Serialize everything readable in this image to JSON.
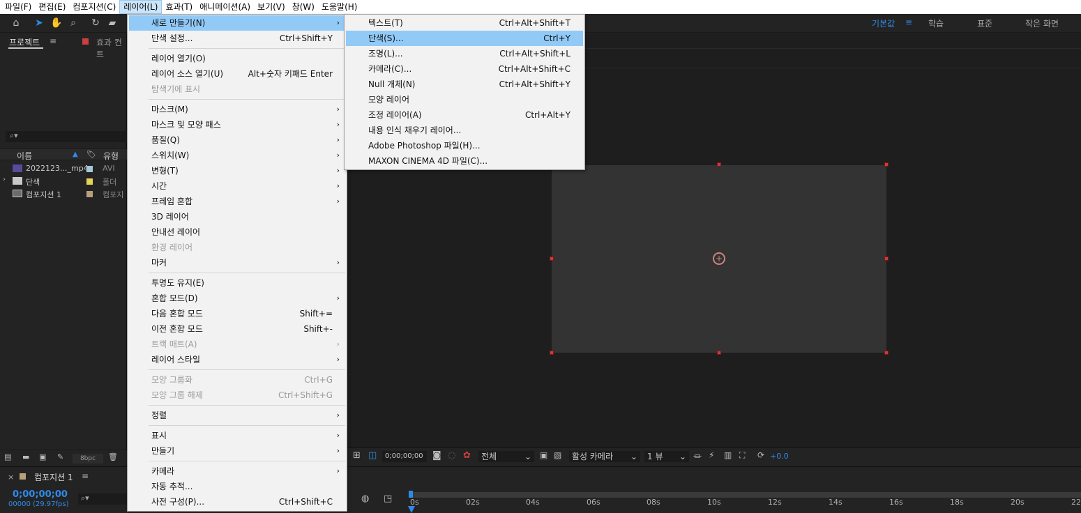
{
  "menubar": {
    "items": [
      "파일(F)",
      "편집(E)",
      "컴포지션(C)",
      "레이어(L)",
      "효과(T)",
      "애니메이션(A)",
      "보기(V)",
      "창(W)",
      "도움말(H)"
    ]
  },
  "workspaces": {
    "active": "기본값",
    "items": [
      "학습",
      "표준",
      "작은 화면"
    ]
  },
  "project_panel": {
    "tab_label": "프로젝트",
    "effects_tab_label": "효과 컨트",
    "columns": {
      "name": "이름",
      "type": "유형"
    },
    "rows": [
      {
        "name": "2022123..._mp4",
        "swatch": "#a6c8d6",
        "type": "AVI"
      },
      {
        "name": "단색",
        "swatch": "#e6d454",
        "type": "폴더"
      },
      {
        "name": "컴포지션 1",
        "swatch": "#b8a07c",
        "type": "컴포지"
      }
    ],
    "bit_depth": "8bpc"
  },
  "timeline": {
    "tab_label": "컴포지션 1",
    "timecode": "0;00;00;00",
    "frame_info": "00000 (29.97fps)",
    "ruler": [
      "0s",
      "02s",
      "04s",
      "06s",
      "08s",
      "10s",
      "12s",
      "14s",
      "16s",
      "18s",
      "20s",
      "22"
    ]
  },
  "viewer_bar": {
    "timecode": "0;00;00;00",
    "resolution": "전체",
    "camera": "활성 카메라",
    "views": "1 뷰",
    "exposure": "+0.0"
  },
  "layer_menu": {
    "items": [
      {
        "label": "새로 만들기(N)",
        "submenu": true,
        "highlight": true
      },
      {
        "label": "단색 설정...",
        "shortcut": "Ctrl+Shift+Y"
      },
      {
        "sep": true
      },
      {
        "label": "레이어 열기(O)"
      },
      {
        "label": "레이어 소스 열기(U)",
        "shortcut": "Alt+숫자 키패드 Enter"
      },
      {
        "label": "탐색기에 표시",
        "disabled": true
      },
      {
        "sep": true
      },
      {
        "label": "마스크(M)",
        "submenu": true
      },
      {
        "label": "마스크 및 모양 패스",
        "submenu": true
      },
      {
        "label": "품질(Q)",
        "submenu": true
      },
      {
        "label": "스위치(W)",
        "submenu": true
      },
      {
        "label": "변형(T)",
        "submenu": true
      },
      {
        "label": "시간",
        "submenu": true
      },
      {
        "label": "프레임 혼합",
        "submenu": true
      },
      {
        "label": "3D 레이어"
      },
      {
        "label": "안내선 레이어"
      },
      {
        "label": "환경 레이어",
        "disabled": true
      },
      {
        "label": "마커",
        "submenu": true
      },
      {
        "sep": true
      },
      {
        "label": "투명도 유지(E)"
      },
      {
        "label": "혼합 모드(D)",
        "submenu": true
      },
      {
        "label": "다음 혼합 모드",
        "shortcut": "Shift+="
      },
      {
        "label": "이전 혼합 모드",
        "shortcut": "Shift+-"
      },
      {
        "label": "트랙 매트(A)",
        "submenu": true,
        "disabled": true
      },
      {
        "label": "레이어 스타일",
        "submenu": true
      },
      {
        "sep": true
      },
      {
        "label": "모양 그룹화",
        "shortcut": "Ctrl+G",
        "disabled": true
      },
      {
        "label": "모양 그룹 해제",
        "shortcut": "Ctrl+Shift+G",
        "disabled": true
      },
      {
        "sep": true
      },
      {
        "label": "정렬",
        "submenu": true
      },
      {
        "sep": true
      },
      {
        "label": "표시",
        "submenu": true
      },
      {
        "label": "만들기",
        "submenu": true
      },
      {
        "sep": true
      },
      {
        "label": "카메라",
        "submenu": true
      },
      {
        "label": "자동 추적..."
      },
      {
        "label": "사전 구성(P)...",
        "shortcut": "Ctrl+Shift+C"
      }
    ]
  },
  "new_submenu": {
    "items": [
      {
        "label": "텍스트(T)",
        "shortcut": "Ctrl+Alt+Shift+T"
      },
      {
        "label": "단색(S)...",
        "shortcut": "Ctrl+Y",
        "highlight": true
      },
      {
        "label": "조명(L)...",
        "shortcut": "Ctrl+Alt+Shift+L"
      },
      {
        "label": "카메라(C)...",
        "shortcut": "Ctrl+Alt+Shift+C"
      },
      {
        "label": "Null 개체(N)",
        "shortcut": "Ctrl+Alt+Shift+Y"
      },
      {
        "label": "모양 레이어"
      },
      {
        "label": "조정 레이어(A)",
        "shortcut": "Ctrl+Alt+Y"
      },
      {
        "label": "내용 인식 채우기 레이어..."
      },
      {
        "label": "Adobe Photoshop 파일(H)..."
      },
      {
        "label": "MAXON CINEMA 4D 파일(C)..."
      }
    ]
  }
}
